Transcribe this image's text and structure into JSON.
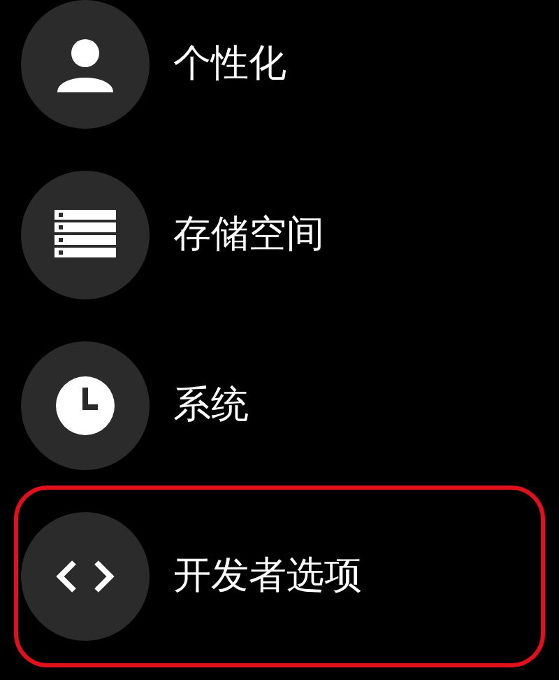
{
  "items": [
    {
      "label": "个性化",
      "highlighted": false
    },
    {
      "label": "存储空间",
      "highlighted": false
    },
    {
      "label": "系统",
      "highlighted": false
    },
    {
      "label": "开发者选项",
      "highlighted": true
    }
  ]
}
